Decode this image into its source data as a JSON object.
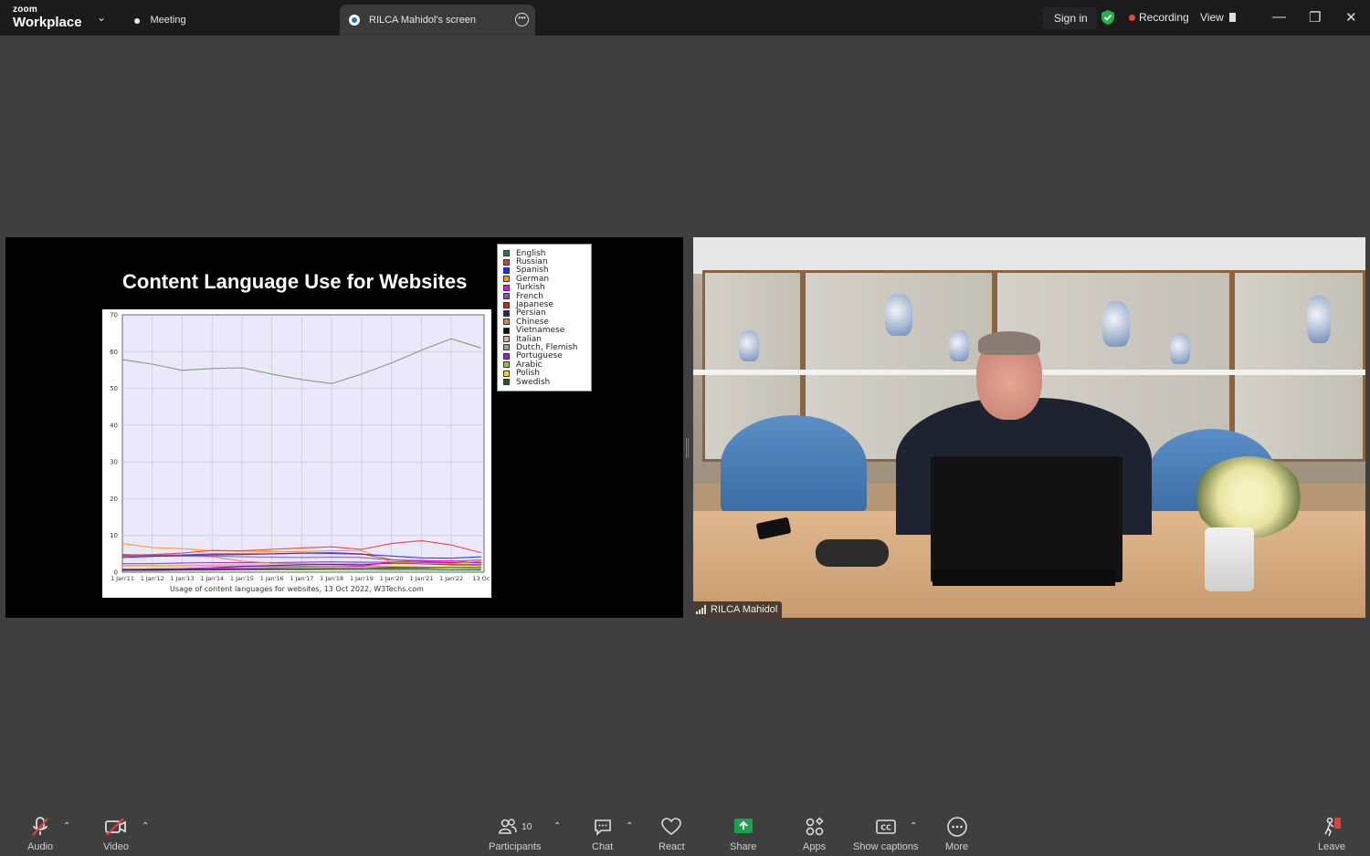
{
  "app": {
    "brand_small": "zoom",
    "brand_big": "Workplace"
  },
  "tabs": [
    {
      "label": "Meeting"
    },
    {
      "label": "RILCA Mahidol's screen"
    }
  ],
  "titlebar": {
    "sign_in": "Sign in",
    "recording": "Recording",
    "view": "View"
  },
  "share": {
    "slide_title": "Content Language Use for Websites",
    "caption": "Usage of content languages for websites, 13 Oct 2022, W3Techs.com"
  },
  "chart_data": {
    "type": "line",
    "title": "Content Language Use for Websites",
    "xlabel": "Usage of content languages for websites, 13 Oct 2022, W3Techs.com",
    "x": [
      "1 Jan'11",
      "1 Jan'12",
      "1 Jan'13",
      "1 Jan'14",
      "1 Jan'15",
      "1 Jan'16",
      "1 Jan'17",
      "1 Jan'18",
      "1 Jan'19",
      "1 Jan'20",
      "1 Jan'21",
      "1 Jan'22",
      "13 Oc"
    ],
    "ylim": [
      0,
      70
    ],
    "yticks": [
      "0",
      "10",
      "20",
      "30",
      "40",
      "50",
      "60",
      "70"
    ],
    "grid": true,
    "legend_position": "top-right",
    "series": [
      {
        "name": "English",
        "color": "#2e7d32",
        "line_color": "#6f9b68",
        "values": [
          57.8,
          56.6,
          54.9,
          55.4,
          55.6,
          53.9,
          52.4,
          51.3,
          53.9,
          56.9,
          60.4,
          63.5,
          61.0
        ]
      },
      {
        "name": "Russian",
        "color": "#e53935",
        "values": [
          4.6,
          4.8,
          5.2,
          5.9,
          5.8,
          6.2,
          6.6,
          6.9,
          6.2,
          7.8,
          8.6,
          7.4,
          5.3
        ]
      },
      {
        "name": "Spanish",
        "color": "#1f2cff",
        "values": [
          4.0,
          4.3,
          4.5,
          4.7,
          4.8,
          5.0,
          5.2,
          5.1,
          4.9,
          4.4,
          3.9,
          3.8,
          4.2
        ]
      },
      {
        "name": "German",
        "color": "#ff9800",
        "values": [
          7.8,
          6.7,
          6.4,
          5.8,
          5.7,
          5.6,
          5.6,
          5.8,
          5.9,
          2.7,
          2.4,
          2.2,
          3.1
        ]
      },
      {
        "name": "Turkish",
        "color": "#ff00ff",
        "values": [
          0.8,
          0.9,
          1.0,
          1.1,
          1.2,
          1.3,
          1.4,
          1.5,
          1.6,
          2.8,
          3.0,
          3.1,
          2.5
        ]
      },
      {
        "name": "French",
        "color": "#7e57c2",
        "values": [
          4.3,
          4.5,
          4.6,
          4.4,
          4.2,
          4.1,
          4.0,
          4.1,
          4.0,
          3.3,
          3.2,
          3.0,
          3.3
        ]
      },
      {
        "name": "Japanese",
        "color": "#c62828",
        "values": [
          4.8,
          4.6,
          4.7,
          5.0,
          5.0,
          5.0,
          5.2,
          5.3,
          5.0,
          3.4,
          2.9,
          2.6,
          2.7
        ]
      },
      {
        "name": "Persian",
        "color": "#1a237e",
        "values": [
          0.8,
          0.9,
          1.0,
          1.2,
          1.6,
          1.8,
          2.0,
          2.1,
          2.0,
          2.5,
          2.3,
          2.0,
          2.0
        ]
      },
      {
        "name": "Chinese",
        "color": "#d2845a",
        "values": [
          4.5,
          4.5,
          4.4,
          4.2,
          3.0,
          2.5,
          2.2,
          2.0,
          1.8,
          1.5,
          1.4,
          1.3,
          1.4
        ]
      },
      {
        "name": "Vietnamese",
        "color": "#111111",
        "values": [
          0.5,
          0.6,
          0.7,
          0.8,
          0.8,
          0.9,
          0.9,
          1.0,
          1.0,
          1.2,
          1.2,
          1.3,
          1.3
        ]
      },
      {
        "name": "Italian",
        "color": "#e6a8a0",
        "values": [
          1.7,
          1.8,
          1.9,
          2.0,
          2.1,
          2.2,
          2.3,
          2.3,
          2.4,
          2.3,
          2.3,
          2.1,
          1.9
        ]
      },
      {
        "name": "Dutch, Flemish",
        "color": "#9e9e9e",
        "values": [
          1.8,
          1.8,
          1.8,
          1.7,
          1.7,
          1.6,
          1.6,
          1.5,
          1.5,
          1.4,
          1.4,
          1.3,
          1.3
        ]
      },
      {
        "name": "Portuguese",
        "color": "#9c27b0",
        "values": [
          2.3,
          2.3,
          2.5,
          2.6,
          2.6,
          2.6,
          2.7,
          2.8,
          2.7,
          2.7,
          2.6,
          2.5,
          2.6
        ]
      },
      {
        "name": "Arabic",
        "color": "#8bc34a",
        "values": [
          0.7,
          0.8,
          0.8,
          0.8,
          0.8,
          0.8,
          0.7,
          0.7,
          0.7,
          1.0,
          1.1,
          1.1,
          0.9
        ]
      },
      {
        "name": "Polish",
        "color": "#ffd600",
        "values": [
          1.5,
          1.6,
          1.7,
          1.8,
          1.7,
          1.7,
          1.6,
          1.6,
          1.6,
          1.6,
          1.5,
          1.5,
          1.6
        ]
      },
      {
        "name": "Swedish",
        "color": "#1b5e20",
        "values": [
          0.5,
          0.5,
          0.6,
          0.6,
          0.7,
          0.7,
          0.7,
          0.7,
          0.7,
          0.7,
          0.7,
          0.6,
          0.6
        ]
      }
    ]
  },
  "video": {
    "participant_name": "RILCA Mahidol"
  },
  "toolbar": {
    "audio": "Audio",
    "video": "Video",
    "participants": "Participants",
    "participants_count": "10",
    "chat": "Chat",
    "react": "React",
    "share": "Share",
    "apps": "Apps",
    "show_captions": "Show captions",
    "more": "More",
    "leave": "Leave"
  },
  "colors": {
    "share_accent": "#1aa34a",
    "leave_red": "#e0403a",
    "recording_red": "#e5463f",
    "shield_green": "#22b04b"
  }
}
